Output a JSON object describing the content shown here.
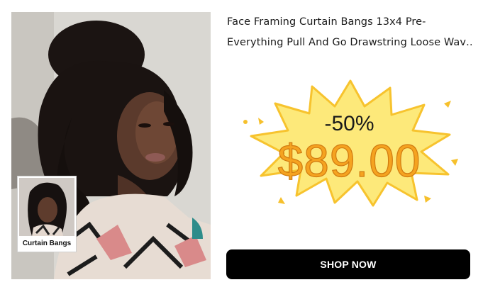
{
  "product": {
    "title_line1": "Face Framing Curtain Bangs 13x4 Pre-",
    "title_line2": "Everything Pull And Go Drawstring Loose Wav…",
    "thumbnail_label": "Curtain Bangs",
    "discount": "-50%",
    "price": "$89.00",
    "cta_label": "SHOP NOW"
  },
  "colors": {
    "burst_fill": "#fde97a",
    "burst_stroke": "#f7c32e",
    "price_text": "#f5a320",
    "button_bg": "#000000",
    "button_text": "#ffffff"
  }
}
